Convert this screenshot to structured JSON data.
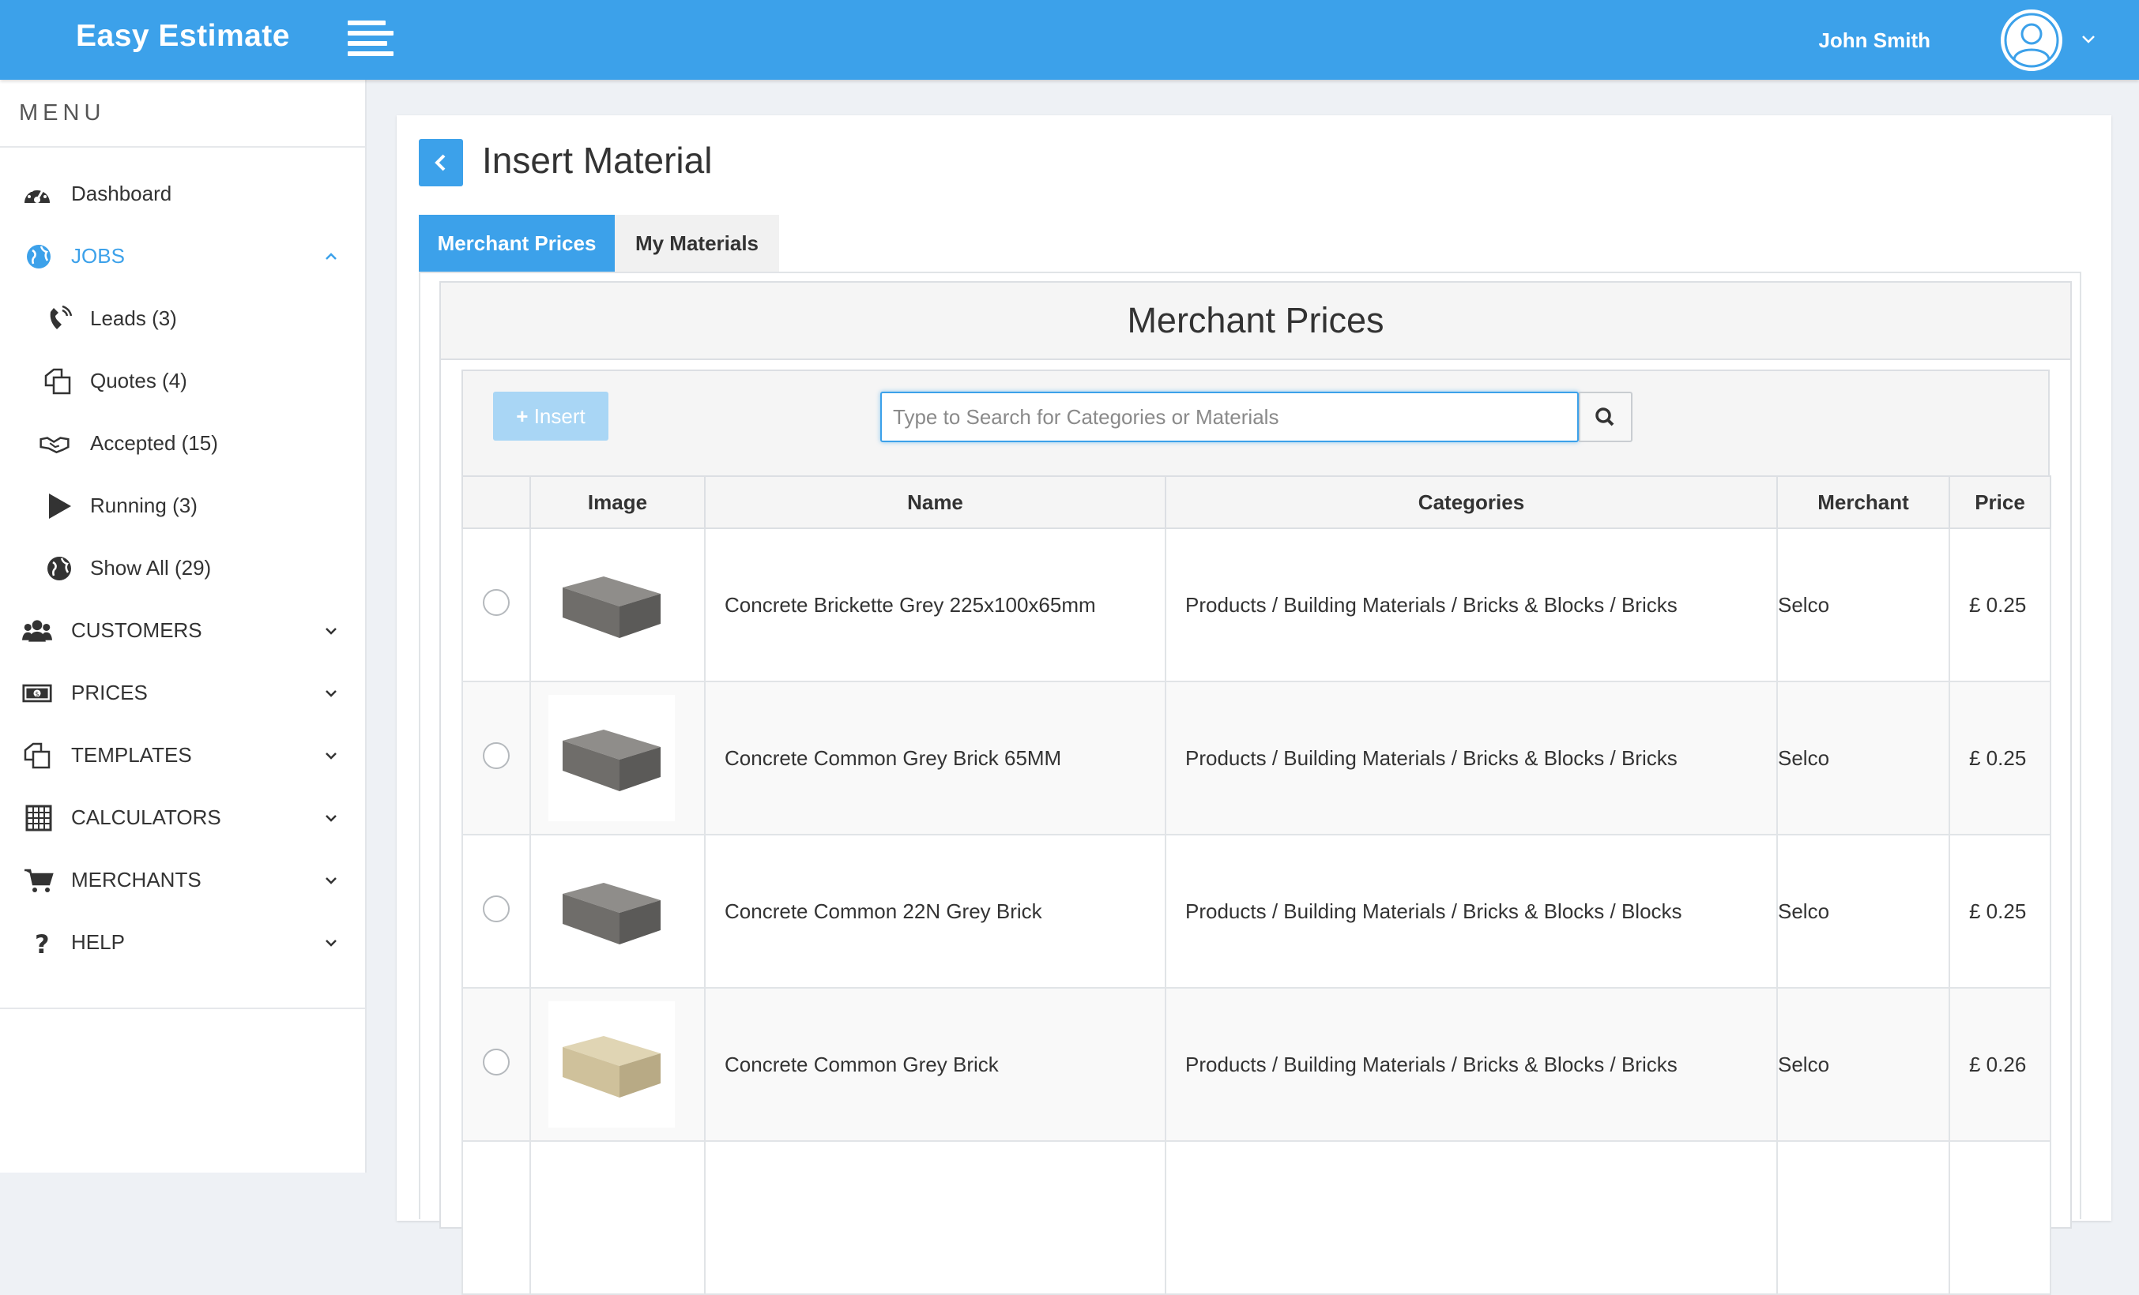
{
  "app": {
    "brand": "Easy Estimate"
  },
  "user": {
    "name": "John Smith"
  },
  "sidebar": {
    "title": "MENU",
    "items": [
      {
        "label": "Dashboard",
        "icon": "dashboard-icon"
      },
      {
        "label": "JOBS",
        "icon": "globe-icon",
        "expanded": true
      },
      {
        "label": "Leads (3)",
        "icon": "phone-icon"
      },
      {
        "label": "Quotes (4)",
        "icon": "documents-icon"
      },
      {
        "label": "Accepted (15)",
        "icon": "handshake-icon"
      },
      {
        "label": "Running (3)",
        "icon": "play-icon"
      },
      {
        "label": "Show All (29)",
        "icon": "globe-icon"
      },
      {
        "label": "CUSTOMERS",
        "icon": "users-icon"
      },
      {
        "label": "PRICES",
        "icon": "money-icon"
      },
      {
        "label": "TEMPLATES",
        "icon": "documents-icon"
      },
      {
        "label": "CALCULATORS",
        "icon": "calculator-icon"
      },
      {
        "label": "MERCHANTS",
        "icon": "cart-icon"
      },
      {
        "label": "HELP",
        "icon": "question-icon"
      }
    ]
  },
  "page": {
    "title": "Insert Material",
    "tabs": [
      "Merchant Prices",
      "My Materials"
    ],
    "active_tab": "Merchant Prices",
    "section_title": "Merchant Prices",
    "insert_label": "Insert",
    "search_placeholder": "Type to Search for Categories or Materials"
  },
  "table": {
    "headers": [
      "Image",
      "Name",
      "Categories",
      "Merchant",
      "Price"
    ],
    "rows": [
      {
        "name": "Concrete Brickette Grey 225x100x65mm",
        "categories": "Products / Building Materials / Bricks & Blocks / Bricks",
        "merchant": "Selco",
        "price": "£ 0.25",
        "image": "grey-brick"
      },
      {
        "name": "Concrete Common Grey Brick 65MM",
        "categories": "Products / Building Materials / Bricks & Blocks / Bricks",
        "merchant": "Selco",
        "price": "£ 0.25",
        "image": "grey-brick"
      },
      {
        "name": "Concrete Common 22N Grey Brick",
        "categories": "Products / Building Materials / Bricks & Blocks / Blocks",
        "merchant": "Selco",
        "price": "£ 0.25",
        "image": "grey-brick"
      },
      {
        "name": "Concrete Common Grey Brick",
        "categories": "Products / Building Materials / Bricks & Blocks / Bricks",
        "merchant": "Selco",
        "price": "£ 0.26",
        "image": "buff-brick"
      }
    ]
  },
  "colors": {
    "accent": "#3ca1ea",
    "page_bg": "#eef1f5"
  }
}
